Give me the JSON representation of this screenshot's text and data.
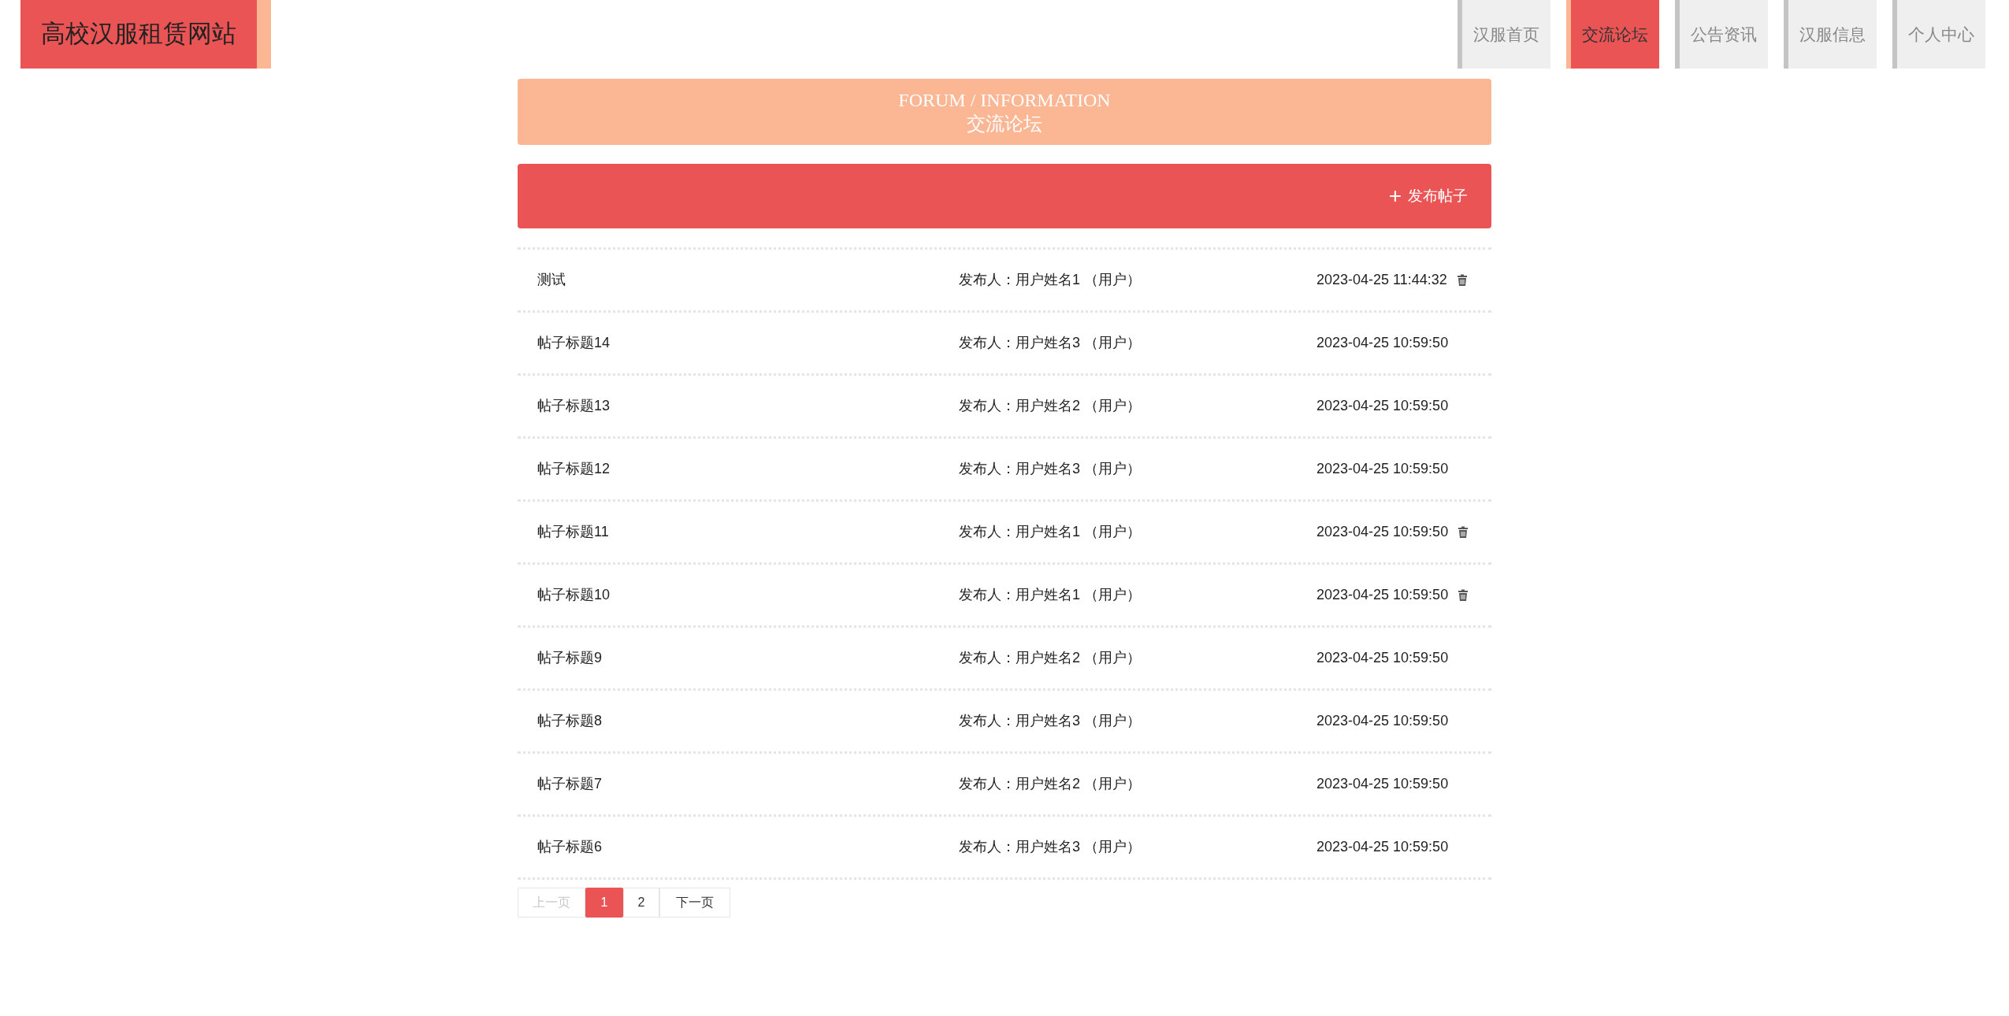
{
  "site_title": "高校汉服租赁网站",
  "nav": [
    {
      "label": "汉服首页",
      "selected": false
    },
    {
      "label": "交流论坛",
      "selected": true
    },
    {
      "label": "公告资讯",
      "selected": false
    },
    {
      "label": "汉服信息",
      "selected": false
    },
    {
      "label": "个人中心",
      "selected": false
    }
  ],
  "banner": {
    "title": "FORUM / INFORMATION",
    "subtitle": "交流论坛"
  },
  "publish_button": {
    "icon": "+",
    "label": "发布帖子"
  },
  "posts": [
    {
      "title": "测试",
      "author": "发布人：用户姓名1 （用户）",
      "time": "2023-04-25 11:44:32",
      "deletable": true
    },
    {
      "title": "帖子标题14",
      "author": "发布人：用户姓名3 （用户）",
      "time": "2023-04-25 10:59:50",
      "deletable": false
    },
    {
      "title": "帖子标题13",
      "author": "发布人：用户姓名2 （用户）",
      "time": "2023-04-25 10:59:50",
      "deletable": false
    },
    {
      "title": "帖子标题12",
      "author": "发布人：用户姓名3 （用户）",
      "time": "2023-04-25 10:59:50",
      "deletable": false
    },
    {
      "title": "帖子标题11",
      "author": "发布人：用户姓名1 （用户）",
      "time": "2023-04-25 10:59:50",
      "deletable": true
    },
    {
      "title": "帖子标题10",
      "author": "发布人：用户姓名1 （用户）",
      "time": "2023-04-25 10:59:50",
      "deletable": true
    },
    {
      "title": "帖子标题9",
      "author": "发布人：用户姓名2 （用户）",
      "time": "2023-04-25 10:59:50",
      "deletable": false
    },
    {
      "title": "帖子标题8",
      "author": "发布人：用户姓名3 （用户）",
      "time": "2023-04-25 10:59:50",
      "deletable": false
    },
    {
      "title": "帖子标题7",
      "author": "发布人：用户姓名2 （用户）",
      "time": "2023-04-25 10:59:50",
      "deletable": false
    },
    {
      "title": "帖子标题6",
      "author": "发布人：用户姓名3 （用户）",
      "time": "2023-04-25 10:59:50",
      "deletable": false
    }
  ],
  "pagination": {
    "prev": {
      "label": "上一页",
      "disabled": true
    },
    "pages": [
      {
        "label": "1",
        "selected": true
      },
      {
        "label": "2",
        "selected": false
      }
    ],
    "next": {
      "label": "下一页",
      "disabled": false
    }
  }
}
